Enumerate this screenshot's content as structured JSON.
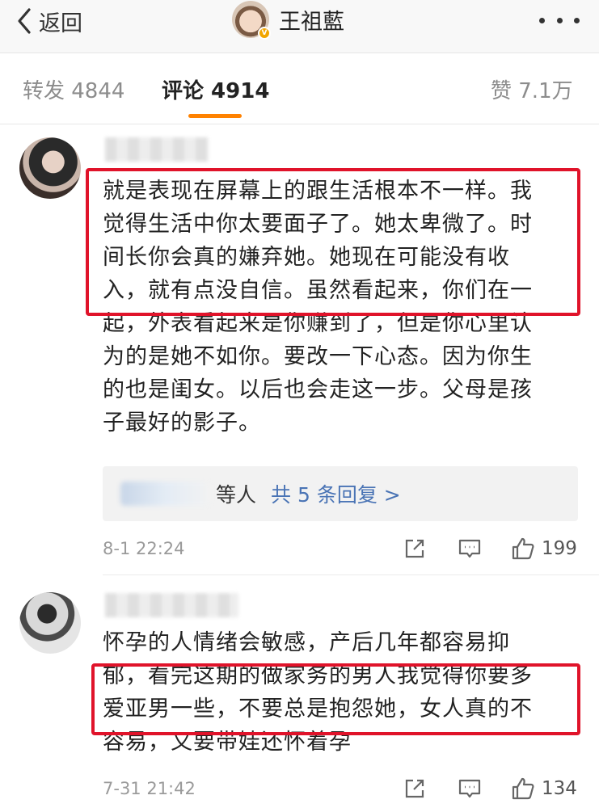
{
  "header": {
    "back_label": "返回",
    "title": "王祖藍"
  },
  "tabs": [
    {
      "label": "转发 4844"
    },
    {
      "label": "评论 4914"
    },
    {
      "label": "赞 7.1万"
    }
  ],
  "comments": [
    {
      "lines": [
        "就是表现在屏幕上的跟生活根本不一样。我",
        "觉得生活中你太要面子了。她太卑微了。时",
        "间长你会真的嫌弃她。她现在可能没有收",
        "入，就有点没自信。虽然看起来，你们在一",
        "起，外表看起来是你赚到了，但是你心里认",
        "为的是她不如你。要改一下心态。因为你生",
        "的也是闺女。以后也会走这一步。父母是孩",
        "子最好的影子。"
      ],
      "replies": {
        "suffix": "等人",
        "link": "共 5 条回复 >"
      },
      "time": "8-1 22:24",
      "likes": "199"
    },
    {
      "lines": [
        "怀孕的人情绪会敏感，产后几年都容易抑",
        "郁，看完这期的做家务的男人我觉得你要多",
        "爱亚男一些，不要总是抱怨她，女人真的不",
        "容易，又要带娃还怀着孕"
      ],
      "time": "7-31 21:42",
      "likes": "134"
    }
  ],
  "colors": {
    "accent": "#ff8200",
    "highlight": "#e0132a",
    "link": "#4a74b5"
  }
}
